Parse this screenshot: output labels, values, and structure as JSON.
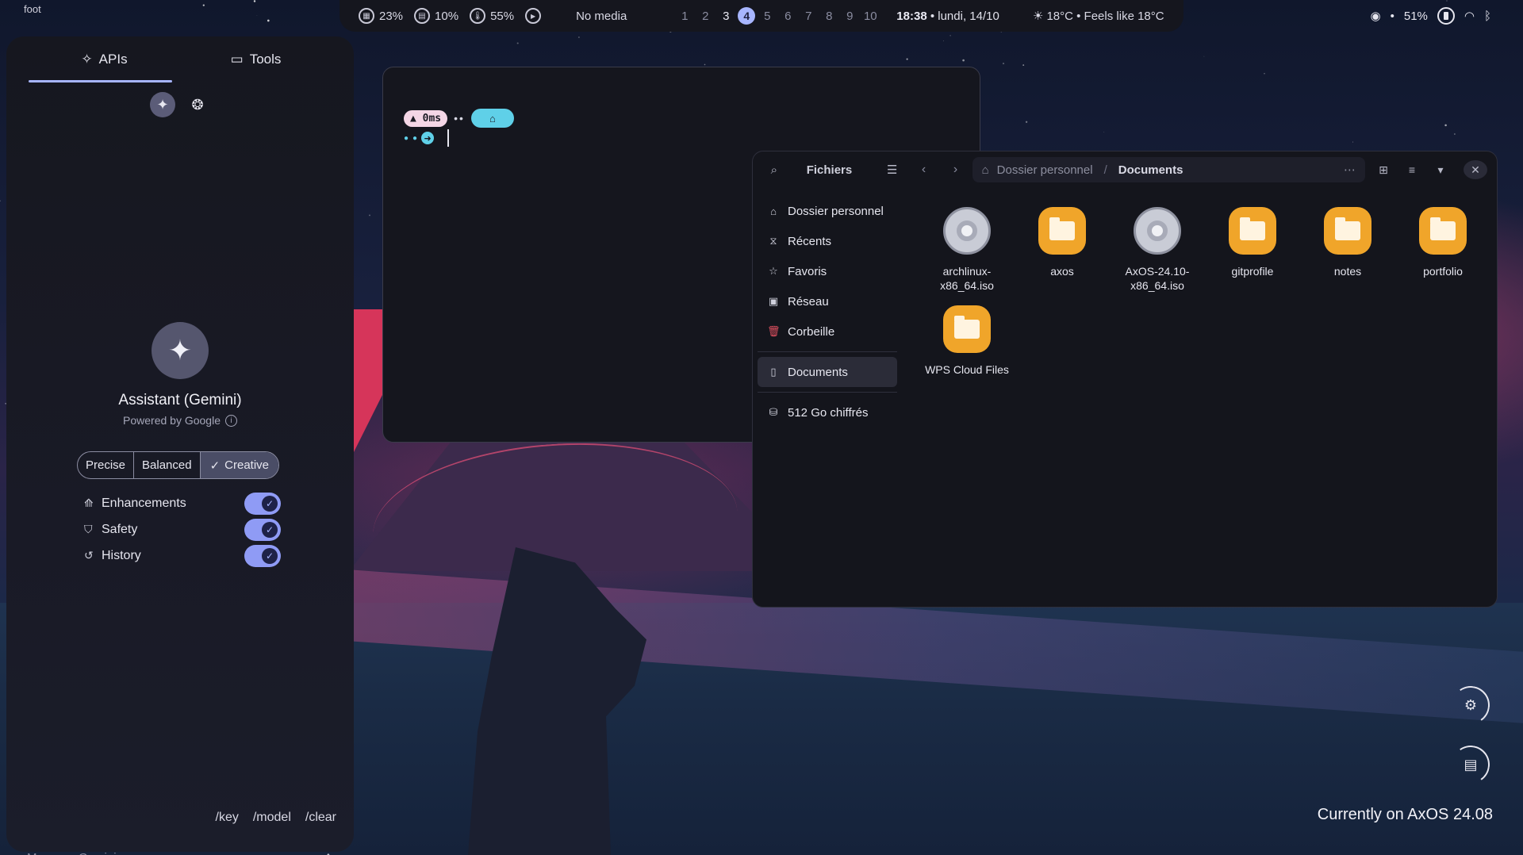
{
  "window_label": "foot",
  "topbar": {
    "cpu": "23%",
    "ram": "10%",
    "temp": "55%",
    "media": "No media",
    "workspaces": [
      "1",
      "2",
      "3",
      "4",
      "5",
      "6",
      "7",
      "8",
      "9",
      "10"
    ],
    "active_workspace": "4",
    "time": "18:38",
    "date": " • lundi, 14/10",
    "weather": "18°C • Feels like 18°C"
  },
  "tray": {
    "battery": "51%",
    "separator": "•"
  },
  "sidebar": {
    "tabs": [
      {
        "label": "APIs",
        "icon": "api-icon",
        "active": true
      },
      {
        "label": "Tools",
        "icon": "toolbox-icon",
        "active": false
      }
    ],
    "assistant_title": "Assistant (Gemini)",
    "assistant_sub": "Powered by Google",
    "temperature_options": [
      "Precise",
      "Balanced",
      "Creative"
    ],
    "temperature_selected": "Creative",
    "toggles": [
      {
        "label": "Enhancements",
        "icon": "enhance-icon",
        "on": true
      },
      {
        "label": "Safety",
        "icon": "shield-icon",
        "on": true
      },
      {
        "label": "History",
        "icon": "history-icon",
        "on": true
      }
    ],
    "commands": [
      "/key",
      "/model",
      "/clear"
    ],
    "input_placeholder": "Message Gemini..."
  },
  "terminal": {
    "duration": "0ms"
  },
  "files": {
    "title": "Fichiers",
    "breadcrumb_home": "Dossier personnel",
    "breadcrumb_sep": "/",
    "breadcrumb_current": "Documents",
    "places": [
      {
        "label": "Dossier personnel",
        "icon": "home-icon"
      },
      {
        "label": "Récents",
        "icon": "clock-icon"
      },
      {
        "label": "Favoris",
        "icon": "star-icon"
      },
      {
        "label": "Réseau",
        "icon": "network-icon"
      },
      {
        "label": "Corbeille",
        "icon": "trash-icon"
      }
    ],
    "bookmark": "Documents",
    "drive": "512 Go chiffrés",
    "items": [
      {
        "name": "archlinux-x86_64.iso",
        "type": "disc"
      },
      {
        "name": "axos",
        "type": "folder"
      },
      {
        "name": "AxOS-24.10-x86_64.iso",
        "type": "disc"
      },
      {
        "name": "gitprofile",
        "type": "folder"
      },
      {
        "name": "notes",
        "type": "folder"
      },
      {
        "name": "portfolio",
        "type": "folder"
      },
      {
        "name": "WPS Cloud Files",
        "type": "folder"
      }
    ]
  },
  "status": {
    "version": "Currently on AxOS 24.08"
  },
  "colors": {
    "accent": "#a7b5ff",
    "folder": "#f0a52a",
    "terminal_cyan": "#5fd0e8",
    "trash": "#e05060"
  }
}
